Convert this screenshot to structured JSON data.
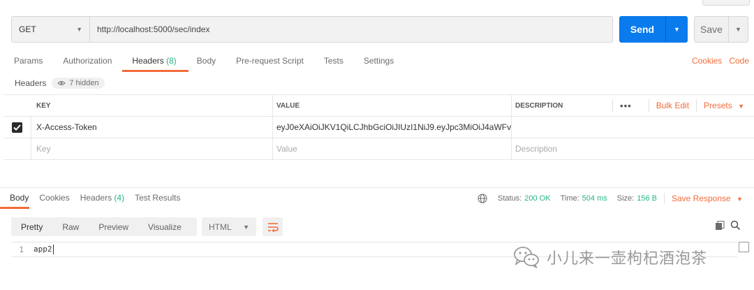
{
  "request": {
    "method": "GET",
    "url": "http://localhost:5000/sec/index",
    "send_label": "Send",
    "save_label": "Save"
  },
  "request_tabs": {
    "params": "Params",
    "authorization": "Authorization",
    "headers": "Headers",
    "headers_count": "(8)",
    "body": "Body",
    "prerequest": "Pre-request Script",
    "tests": "Tests",
    "settings": "Settings",
    "cookies_link": "Cookies",
    "code_link": "Code"
  },
  "headers_section": {
    "title": "Headers",
    "hidden_label": "7 hidden"
  },
  "table": {
    "col_key": "KEY",
    "col_value": "VALUE",
    "col_description": "DESCRIPTION",
    "bulk_edit": "Bulk Edit",
    "presets": "Presets",
    "rows": [
      {
        "checked": true,
        "key": "X-Access-Token",
        "value": "eyJ0eXAiOiJKV1QiLCJhbGciOiJIUzI1NiJ9.eyJpc3MiOiJ4aWFve...",
        "description": ""
      }
    ],
    "placeholder": {
      "key": "Key",
      "value": "Value",
      "description": "Description"
    }
  },
  "response_tabs": {
    "body": "Body",
    "cookies": "Cookies",
    "headers": "Headers",
    "headers_count": "(4)",
    "test_results": "Test Results"
  },
  "response_status": {
    "status_label": "Status:",
    "status_value": "200 OK",
    "time_label": "Time:",
    "time_value": "504 ms",
    "size_label": "Size:",
    "size_value": "156 B",
    "save_response": "Save Response"
  },
  "format_bar": {
    "pretty": "Pretty",
    "raw": "Raw",
    "preview": "Preview",
    "visualize": "Visualize",
    "language": "HTML"
  },
  "editor": {
    "line_number": "1",
    "code": "app2"
  },
  "watermark": {
    "text": "小儿来一壶枸杞酒泡茶"
  },
  "colors": {
    "accent_orange": "#f26b3a",
    "send_blue": "#097bed",
    "status_green": "#26b47f"
  }
}
